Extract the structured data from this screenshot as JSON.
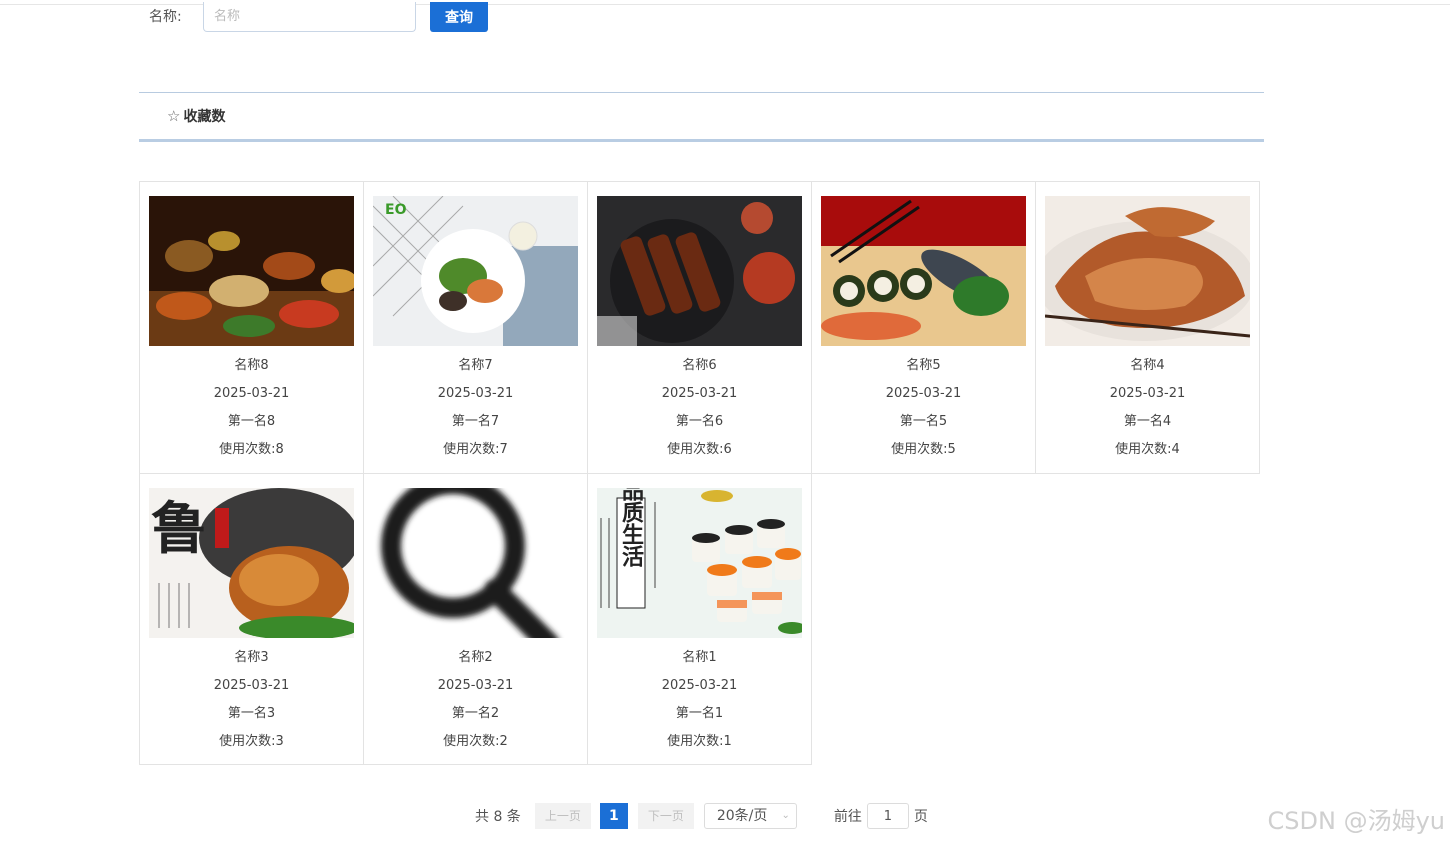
{
  "search": {
    "label": "名称:",
    "placeholder": "名称",
    "button_label": "查询"
  },
  "tabs": [
    {
      "label": "收藏数",
      "icon": "star-icon"
    }
  ],
  "cards": [
    {
      "name": "名称8",
      "date": "2025-03-21",
      "rank": "第一名8",
      "usage": "使用次数:8",
      "image": "food-platter"
    },
    {
      "name": "名称7",
      "date": "2025-03-21",
      "rank": "第一名7",
      "usage": "使用次数:7",
      "image": "salad-bowl"
    },
    {
      "name": "名称6",
      "date": "2025-03-21",
      "rank": "第一名6",
      "usage": "使用次数:6",
      "image": "bbq-skewers"
    },
    {
      "name": "名称5",
      "date": "2025-03-21",
      "rank": "第一名5",
      "usage": "使用次数:5",
      "image": "sushi-fish"
    },
    {
      "name": "名称4",
      "date": "2025-03-21",
      "rank": "第一名4",
      "usage": "使用次数:4",
      "image": "roast-meat"
    },
    {
      "name": "名称3",
      "date": "2025-03-21",
      "rank": "第一名3",
      "usage": "使用次数:3",
      "image": "roast-chicken"
    },
    {
      "name": "名称2",
      "date": "2025-03-21",
      "rank": "第一名2",
      "usage": "使用次数:2",
      "image": "magnifier-placeholder"
    },
    {
      "name": "名称1",
      "date": "2025-03-21",
      "rank": "第一名1",
      "usage": "使用次数:1",
      "image": "sushi-rolls"
    }
  ],
  "image_text": {
    "eo_logo": "EO",
    "lu_char": "鲁",
    "sushi_poster": "品质生活"
  },
  "pagination": {
    "total": "共 8 条",
    "prev": "上一页",
    "current": "1",
    "next": "下一页",
    "page_size": "20条/页",
    "goto_label": "前往",
    "goto_value": "1",
    "page_suffix": "页"
  },
  "watermark": "CSDN @汤姆yu",
  "colors": {
    "primary": "#1b6fd6",
    "tab_border": "#b9cde3"
  }
}
